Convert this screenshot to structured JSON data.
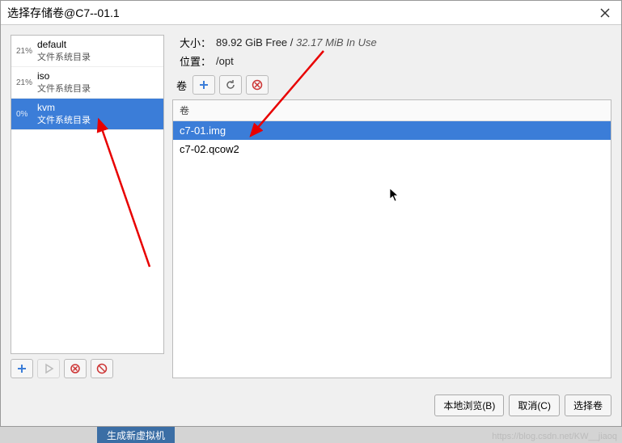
{
  "window": {
    "title": "选择存储卷@C7--01.1"
  },
  "pools": [
    {
      "pct": "21%",
      "name": "default",
      "type": "文件系统目录",
      "selected": false
    },
    {
      "pct": "21%",
      "name": "iso",
      "type": "文件系统目录",
      "selected": false
    },
    {
      "pct": "0%",
      "name": "kvm",
      "type": "文件系统目录",
      "selected": true
    }
  ],
  "info": {
    "size_label": "大小：",
    "size_free": "89.92 GiB Free",
    "size_sep": " / ",
    "size_inuse": "32.17 MiB In Use",
    "location_label": "位置：",
    "location_value": "/opt",
    "vol_label": "卷"
  },
  "vol_header": "卷",
  "volumes": [
    {
      "name": "c7-01.img",
      "selected": true
    },
    {
      "name": "c7-02.qcow2",
      "selected": false
    }
  ],
  "footer": {
    "browse": "本地浏览(B)",
    "cancel": "取消(C)",
    "choose": "选择卷"
  },
  "bg_task": "生成新虚拟机",
  "watermark": "https://blog.csdn.net/KW__jiaoq"
}
